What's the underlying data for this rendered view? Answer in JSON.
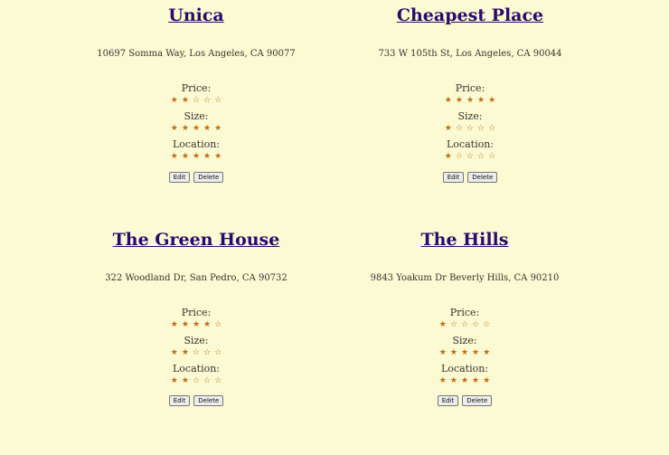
{
  "actions": {
    "edit_label": "Edit",
    "delete_label": "Delete"
  },
  "rating_labels": {
    "price": "Price:",
    "size": "Size:",
    "location": "Location:"
  },
  "places": [
    {
      "name": "Unica",
      "address": "10697 Somma Way, Los Angeles, CA 90077",
      "ratings": {
        "price": 2,
        "size": 5,
        "location": 5
      }
    },
    {
      "name": "Cheapest Place",
      "address": "733 W 105th St, Los Angeles, CA 90044",
      "ratings": {
        "price": 5,
        "size": 1,
        "location": 1
      }
    },
    {
      "name": "The Green House",
      "address": "322 Woodland Dr, San Pedro, CA 90732",
      "ratings": {
        "price": 4,
        "size": 2,
        "location": 2
      }
    },
    {
      "name": "The Hills",
      "address": "9843 Yoakum Dr Beverly Hills, CA 90210",
      "ratings": {
        "price": 1,
        "size": 5,
        "location": 5
      }
    }
  ],
  "star_scale": 5,
  "colors": {
    "background": "#fbfad2",
    "title_link": "#2c0a6b",
    "star": "#c16a10"
  }
}
